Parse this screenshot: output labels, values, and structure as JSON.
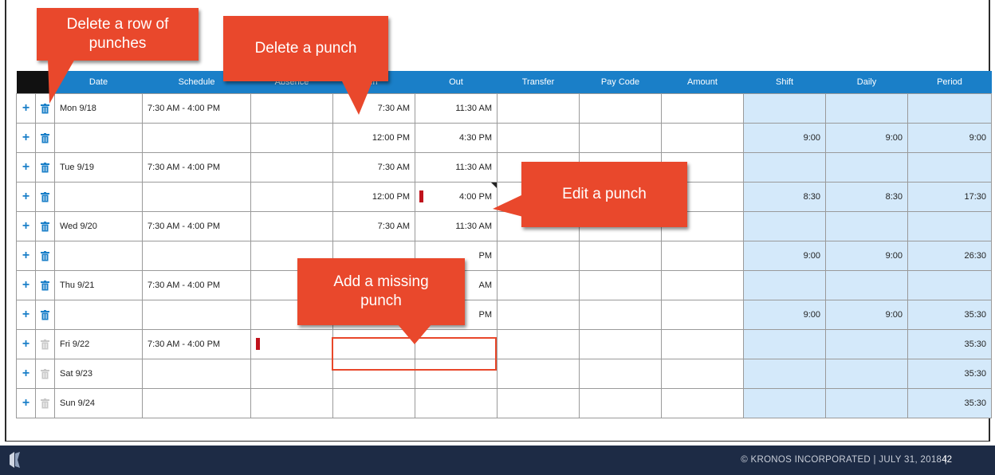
{
  "table": {
    "headers": {
      "date": "Date",
      "schedule": "Schedule",
      "absence": "Absence",
      "in": "In",
      "out": "Out",
      "transfer": "Transfer",
      "pay_code": "Pay Code",
      "amount": "Amount",
      "shift": "Shift",
      "daily": "Daily",
      "period": "Period"
    },
    "rows": [
      {
        "date": "Mon 9/18",
        "schedule": "7:30 AM - 4:00 PM",
        "in": "7:30 AM",
        "out": "11:30 AM",
        "shift": "",
        "daily": "",
        "period": ""
      },
      {
        "date": "",
        "schedule": "",
        "in": "12:00 PM",
        "out": "4:30 PM",
        "shift": "9:00",
        "daily": "9:00",
        "period": "9:00"
      },
      {
        "date": "Tue 9/19",
        "schedule": "7:30 AM - 4:00 PM",
        "in": "7:30 AM",
        "out": "11:30 AM",
        "shift": "",
        "daily": "",
        "period": ""
      },
      {
        "date": "",
        "schedule": "",
        "in": "12:00 PM",
        "out": "4:00 PM",
        "shift": "8:30",
        "daily": "8:30",
        "period": "17:30"
      },
      {
        "date": "Wed 9/20",
        "schedule": "7:30 AM - 4:00 PM",
        "in": "7:30 AM",
        "out": "11:30 AM",
        "shift": "",
        "daily": "",
        "period": ""
      },
      {
        "date": "",
        "schedule": "",
        "in": "",
        "out": "PM",
        "shift": "9:00",
        "daily": "9:00",
        "period": "26:30"
      },
      {
        "date": "Thu 9/21",
        "schedule": "7:30 AM - 4:00 PM",
        "in": "",
        "out": "AM",
        "shift": "",
        "daily": "",
        "period": ""
      },
      {
        "date": "",
        "schedule": "",
        "in": "",
        "out": "PM",
        "shift": "9:00",
        "daily": "9:00",
        "period": "35:30"
      },
      {
        "date": "Fri 9/22",
        "schedule": "7:30 AM - 4:00 PM",
        "in": "",
        "out": "",
        "shift": "",
        "daily": "",
        "period": "35:30"
      },
      {
        "date": "Sat 9/23",
        "schedule": "",
        "in": "",
        "out": "",
        "shift": "",
        "daily": "",
        "period": "35:30"
      },
      {
        "date": "Sun 9/24",
        "schedule": "",
        "in": "",
        "out": "",
        "shift": "",
        "daily": "",
        "period": "35:30"
      }
    ]
  },
  "callouts": {
    "delete_row": {
      "line1": "Delete a row of",
      "line2": "punches"
    },
    "delete_punch": "Delete a punch",
    "edit_punch": "Edit a punch",
    "add_missing": {
      "line1": "Add a missing",
      "line2": "punch"
    }
  },
  "icons": {
    "add": "plus-icon",
    "delete_row": "trash-icon",
    "exception_flag": "red-flag-icon",
    "comment": "corner-triangle-icon",
    "logo": "kronos-logo-icon"
  },
  "colors": {
    "header_blue": "#1a7fc8",
    "totals_bg": "#d4e9fa",
    "callout": "#e9482c",
    "flag_red": "#c0121c",
    "footer_bg": "#1d2b45"
  },
  "footer": {
    "copyright": "© KRONOS INCORPORATED  |  JULY 31, 2018  |",
    "page_number": "42"
  }
}
